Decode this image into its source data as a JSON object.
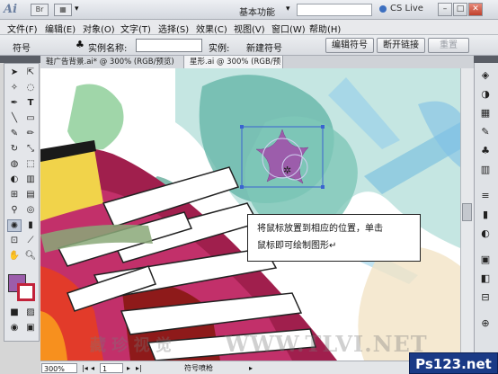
{
  "app": {
    "logo_text": "Ai",
    "workspace": "基本功能",
    "cslive": "CS Live"
  },
  "window_controls": {
    "minimize": "–",
    "restore": "□",
    "close": "✕"
  },
  "menu": [
    "文件(F)",
    "编辑(E)",
    "对象(O)",
    "文字(T)",
    "选择(S)",
    "效果(C)",
    "视图(V)",
    "窗口(W)",
    "帮助(H)"
  ],
  "controlbar": {
    "object_type": "符号",
    "instance_name_label": "实例名称:",
    "instance_name_value": "",
    "instance_label": "实例:",
    "instance_value": "新建符号",
    "edit_symbol": "编辑符号",
    "break_link": "断开链接",
    "reset": "重置"
  },
  "tabs": [
    {
      "label": "鞋广告背景.ai* @ 300% (RGB/预览)"
    },
    {
      "label": "星形.ai @ 300% (RGB/预览)"
    }
  ],
  "callout": {
    "line1": "将鼠标放置到相应的位置，单击",
    "line2": "鼠标即可绘制图形↵"
  },
  "status": {
    "zoom": "300%",
    "page": "1",
    "current_tool": "符号喷枪"
  },
  "watermark": {
    "logo": "Ps123.net",
    "url": "WWW.TLVI.NET",
    "cn": "藏 珍 视 觉"
  },
  "colors": {
    "fill": "#9c5dab",
    "stroke": "#c2223a"
  }
}
